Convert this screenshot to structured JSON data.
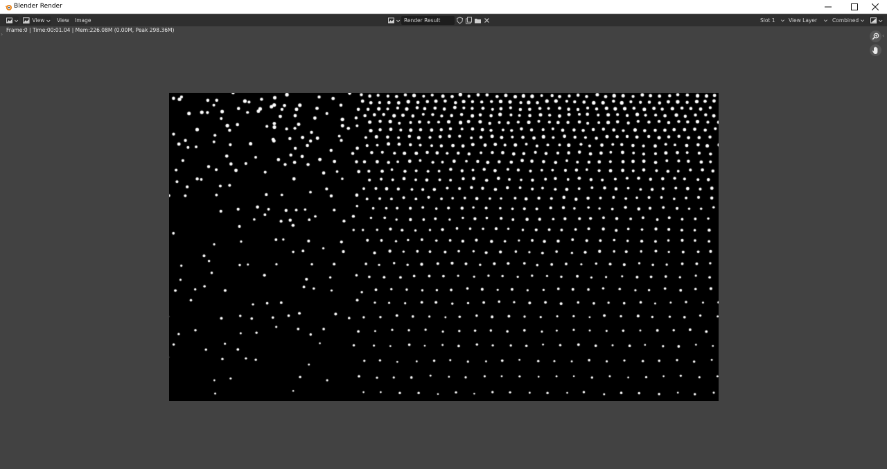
{
  "window": {
    "title": "Blender Render",
    "minimize_icon": "minimize-icon",
    "maximize_icon": "maximize-icon",
    "close_icon": "close-icon"
  },
  "header": {
    "editor_type_icon": "image-editor-icon",
    "view_mode_label": "View",
    "menus": [
      "View",
      "Image"
    ],
    "image_name": "Render Result",
    "slot": "Slot 1",
    "view_layer": "View Layer",
    "pass": "Combined"
  },
  "info": {
    "text": "Frame:0 | Time:00:01.04 | Mem:226.08M (0.00M, Peak 298.36M)"
  },
  "tools": [
    "zoom-icon",
    "hand-pan-icon"
  ],
  "render": {
    "background": "#000000",
    "dot_color": "#ffffff"
  }
}
